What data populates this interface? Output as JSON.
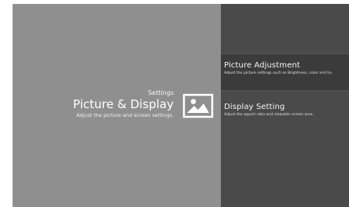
{
  "header": {
    "section_label": "Settings",
    "title": "Picture & Display",
    "subtitle": "Adjust the picture and screen settings."
  },
  "icon": {
    "name": "picture-icon"
  },
  "menu": {
    "items": [
      {
        "title": "Picture Adjustment",
        "description": "Adjust the picture settings such as Brightness, color and hu"
      },
      {
        "title": "Display Setting",
        "description": "Adjust the aspect ratio and viewable screen area."
      }
    ],
    "selected_index": 0
  },
  "colors": {
    "left_panel": "#8f8f8f",
    "right_panel": "#4a4a4a",
    "selected_item": "#3b3b3b",
    "text": "#ffffff"
  }
}
